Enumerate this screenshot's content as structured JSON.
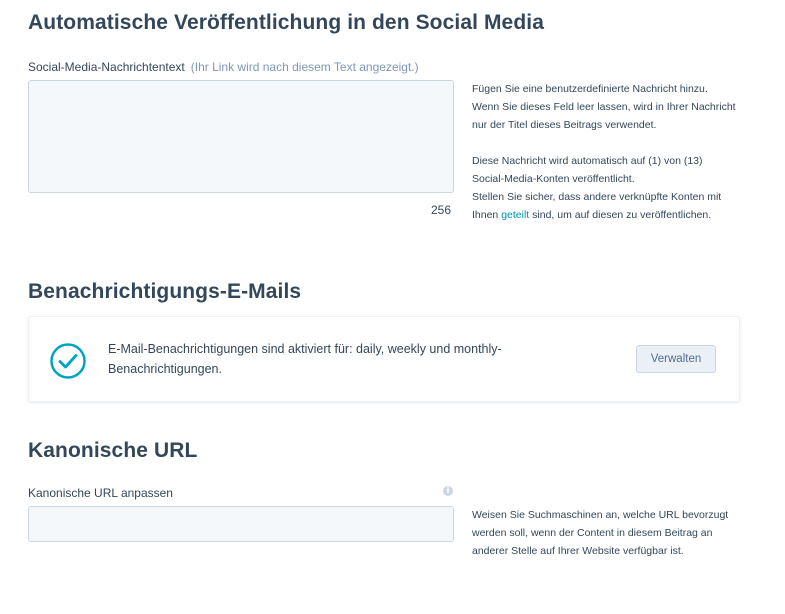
{
  "social": {
    "title": "Automatische Veröffentlichung in den Social Media",
    "label": "Social-Media-Nachrichtentext",
    "hint": "(Ihr Link wird nach diesem Text angezeigt.)",
    "value": "",
    "counter": "256",
    "help_p1": "Fügen Sie eine benutzerdefinierte Nachricht hinzu. Wenn Sie dieses Feld leer lassen, wird in Ihrer Nachricht nur der Titel dieses Beitrags verwendet.",
    "help_p2_line1": "Diese Nachricht wird automatisch auf (1) von (13) Social-Media-Konten veröffentlicht.",
    "help_p2_line2_before": "Stellen Sie sicher, dass andere verknüpfte Konten mit Ihnen ",
    "help_p2_link": "geteilt",
    "help_p2_line2_after": " sind, um auf diesen zu veröffentlichen."
  },
  "notifications": {
    "title": "Benachrichtigungs-E-Mails",
    "icon": "check-circle-icon",
    "text": "E-Mail-Benachrichtigungen sind aktiviert für: daily, weekly und monthly-Benachrichtigungen.",
    "manage_label": "Verwalten"
  },
  "canonical": {
    "title": "Kanonische URL",
    "label": "Kanonische URL anpassen",
    "info_icon": "info-icon",
    "value": "",
    "help": "Weisen Sie Suchmaschinen an, welche URL bevorzugt werden soll, wenn der Content in diesem Beitrag an anderer Stelle auf Ihrer Website verfügbar ist."
  },
  "colors": {
    "heading": "#33475b",
    "hint": "#7c98b6",
    "link": "#0091ae",
    "check": "#00a4bd",
    "input_bg": "#f5f8fa",
    "input_border": "#cbd6e2"
  }
}
